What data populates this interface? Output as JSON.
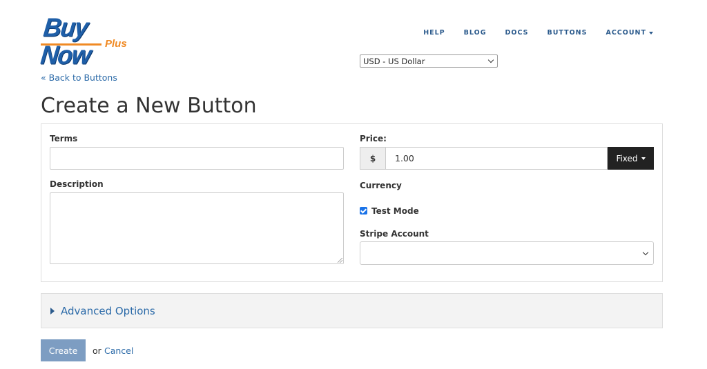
{
  "logo": {
    "main": "Buy Now",
    "sub": "Plus"
  },
  "nav": {
    "items": [
      {
        "label": "HELP"
      },
      {
        "label": "BLOG"
      },
      {
        "label": "DOCS"
      },
      {
        "label": "BUTTONS"
      },
      {
        "label": "ACCOUNT"
      }
    ]
  },
  "back_link": "« Back to Buttons",
  "page_title": "Create a New Button",
  "form": {
    "terms_label": "Terms",
    "terms_value": "",
    "description_label": "Description",
    "description_value": "",
    "price_label": "Price:",
    "price_addon": "$",
    "price_value": "1.00",
    "price_type": "Fixed",
    "currency_label": "Currency",
    "currency_value": "USD - US Dollar",
    "test_mode_label": "Test Mode",
    "test_mode_checked": true,
    "stripe_account_label": "Stripe Account",
    "stripe_account_value": ""
  },
  "advanced_label": "Advanced Options",
  "actions": {
    "create_label": "Create",
    "or_text": "or",
    "cancel_label": "Cancel"
  },
  "colors": {
    "brand_blue": "#1f5fa8",
    "brand_orange": "#f08a24",
    "link": "#2b6aa8",
    "create_button": "#7d9dc2",
    "fixed_button": "#222222"
  }
}
